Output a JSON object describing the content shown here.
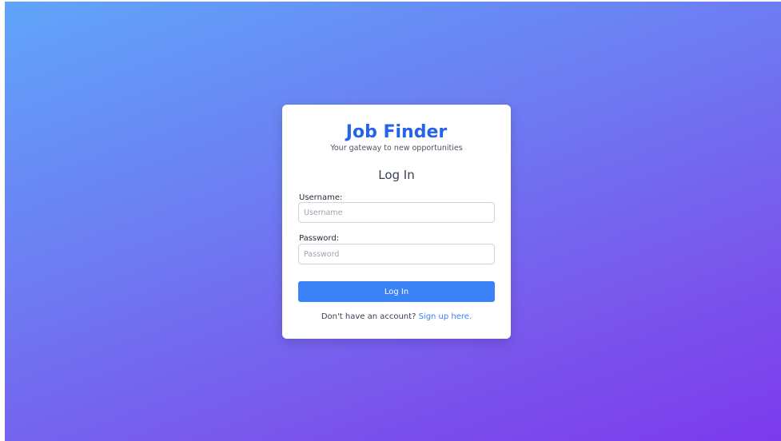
{
  "app": {
    "title": "Job Finder",
    "tagline": "Your gateway to new opportunities"
  },
  "form": {
    "heading": "Log In",
    "username": {
      "label": "Username:",
      "placeholder": "Username",
      "value": ""
    },
    "password": {
      "label": "Password:",
      "placeholder": "Password",
      "value": ""
    },
    "submit_label": "Log In"
  },
  "signup": {
    "prompt": "Don't have an account?",
    "link_text": "Sign up here."
  },
  "colors": {
    "accent": "#3b82f6",
    "title": "#2563eb",
    "gradient_start": "#60a5fa",
    "gradient_end": "#7c3aed"
  }
}
